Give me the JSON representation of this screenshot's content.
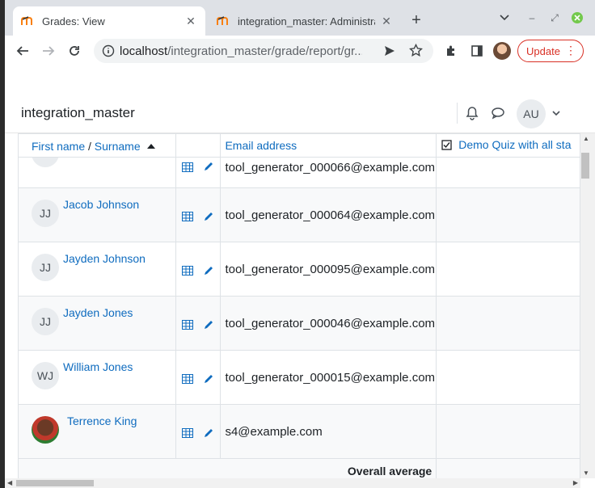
{
  "browser": {
    "tabs": [
      {
        "title": "Grades: View",
        "active": true
      },
      {
        "title": "integration_master: Administra",
        "active": false
      }
    ],
    "url_host": "localhost",
    "url_path": "/integration_master/grade/report/gr...",
    "update_label": "Update"
  },
  "site": {
    "name": "integration_master",
    "user_initials": "AU"
  },
  "table": {
    "headers": {
      "first_name": "First name",
      "separator": " / ",
      "surname": "Surname",
      "email": "Email address",
      "quiz": "Demo Quiz with all sta"
    },
    "partial_row_email": "tool_generator_000066@example.com",
    "rows": [
      {
        "initials": "JJ",
        "name": "Jacob Johnson",
        "email": "tool_generator_000064@example.com"
      },
      {
        "initials": "JJ",
        "name": "Jayden Johnson",
        "email": "tool_generator_000095@example.com"
      },
      {
        "initials": "JJ",
        "name": "Jayden Jones",
        "email": "tool_generator_000046@example.com"
      },
      {
        "initials": "WJ",
        "name": "William Jones",
        "email": "tool_generator_000015@example.com"
      },
      {
        "initials": "",
        "name": "Terrence King",
        "email": "s4@example.com"
      }
    ],
    "overall_average_label": "Overall average"
  }
}
